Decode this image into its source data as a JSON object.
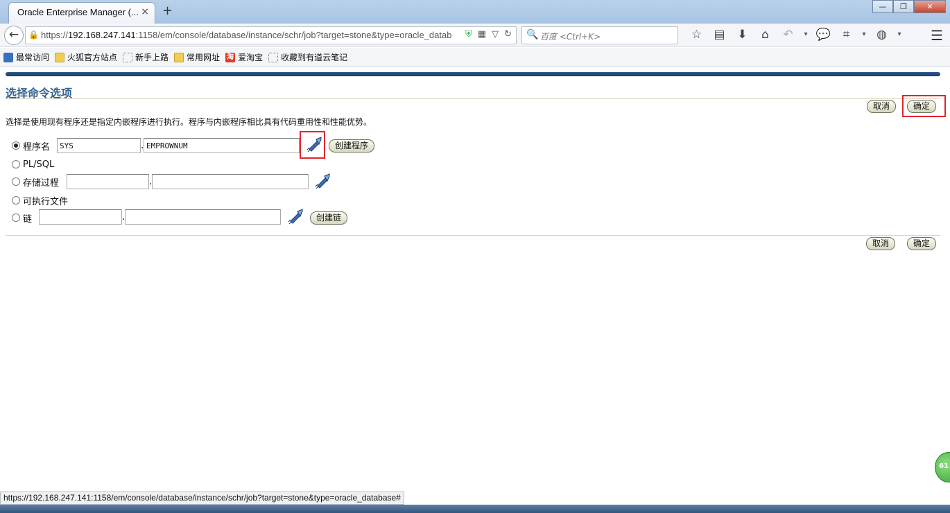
{
  "browser": {
    "tab_title": "Oracle Enterprise Manager (...",
    "tab_close": "×",
    "new_tab": "+",
    "url_prefix": "https://",
    "url_host": "192.168.247.141",
    "url_rest": ":1158/em/console/database/instance/schr/job?target=stone&type=oracle_datab",
    "search_placeholder": "百度 <Ctrl+K>",
    "window_controls": [
      "—",
      "❐",
      "✕"
    ]
  },
  "bookmarks": [
    {
      "label": "最常访问",
      "icon": "most-visited-icon"
    },
    {
      "label": "火狐官方站点",
      "icon": "folder-icon"
    },
    {
      "label": "新手上路",
      "icon": "dashed-page-icon"
    },
    {
      "label": "常用网址",
      "icon": "folder-icon"
    },
    {
      "label": "爱淘宝",
      "icon": "taobao-icon",
      "glyph": "淘"
    },
    {
      "label": "收藏到有道云笔记",
      "icon": "dashed-page-icon"
    }
  ],
  "page": {
    "title": "选择命令选项",
    "description": "选择是使用现有程序还是指定内嵌程序进行执行。程序与内嵌程序相比具有代码重用性和性能优势。",
    "cancel_label": "取消",
    "ok_label": "确定",
    "options": {
      "program": {
        "label": "程序名",
        "schema": "SYS",
        "name": "EMPROWNUM",
        "create_label": "创建程序",
        "selected": true
      },
      "plsql": {
        "label": "PL/SQL",
        "selected": false
      },
      "stored_procedure": {
        "label": "存储过程",
        "schema": "",
        "name": "",
        "selected": false
      },
      "executable": {
        "label": "可执行文件",
        "selected": false
      },
      "chain": {
        "label": "链",
        "schema": "",
        "name": "",
        "create_label": "创建链",
        "selected": false
      }
    }
  },
  "status_bar": "https://192.168.247.141:1158/em/console/database/instance/schr/job?target=stone&type=oracle_database#",
  "side_badge": "61",
  "colors": {
    "title": "#33628f",
    "highlight": "#e0262d",
    "brand_bar": "#1b3d66"
  }
}
